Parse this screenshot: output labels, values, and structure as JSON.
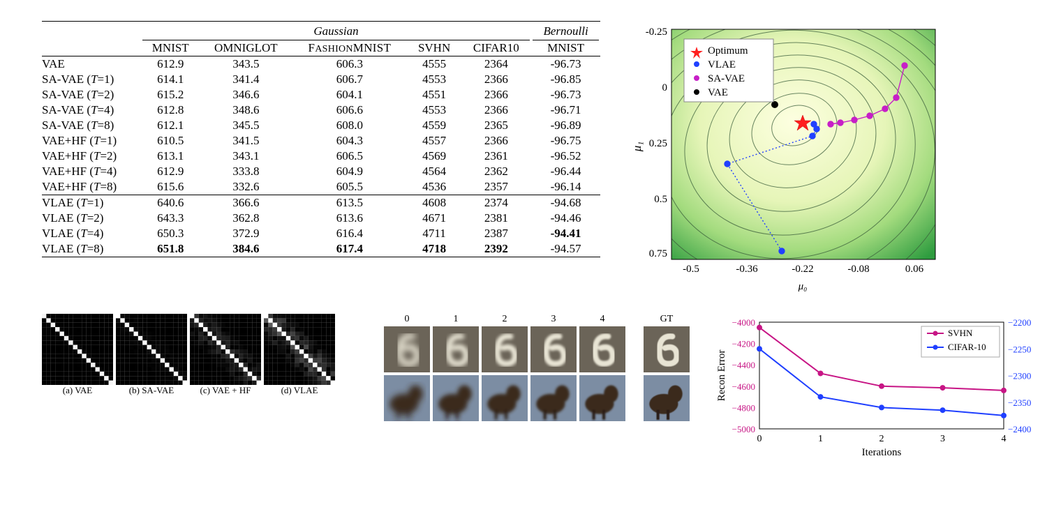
{
  "table": {
    "group1": "Gaussian",
    "group2": "Bernoulli",
    "cols": [
      "MNIST",
      "OMNIGLOT",
      "FASHIONMNIST",
      "SVHN",
      "CIFAR10"
    ],
    "col_b": "MNIST",
    "rows": [
      {
        "name": "VAE",
        "v": [
          "612.9",
          "343.5",
          "606.3",
          "4555",
          "2364",
          "-96.73"
        ]
      },
      {
        "name": "SA-VAE (T=1)",
        "v": [
          "614.1",
          "341.4",
          "606.7",
          "4553",
          "2366",
          "-96.85"
        ]
      },
      {
        "name": "SA-VAE (T=2)",
        "v": [
          "615.2",
          "346.6",
          "604.1",
          "4551",
          "2366",
          "-96.73"
        ]
      },
      {
        "name": "SA-VAE (T=4)",
        "v": [
          "612.8",
          "348.6",
          "606.6",
          "4553",
          "2366",
          "-96.71"
        ]
      },
      {
        "name": "SA-VAE (T=8)",
        "v": [
          "612.1",
          "345.5",
          "608.0",
          "4559",
          "2365",
          "-96.89"
        ]
      },
      {
        "name": "VAE+HF (T=1)",
        "v": [
          "610.5",
          "341.5",
          "604.3",
          "4557",
          "2366",
          "-96.75"
        ]
      },
      {
        "name": "VAE+HF (T=2)",
        "v": [
          "613.1",
          "343.1",
          "606.5",
          "4569",
          "2361",
          "-96.52"
        ]
      },
      {
        "name": "VAE+HF (T=4)",
        "v": [
          "612.9",
          "333.8",
          "604.9",
          "4564",
          "2362",
          "-96.44"
        ]
      },
      {
        "name": "VAE+HF (T=8)",
        "v": [
          "615.6",
          "332.6",
          "605.5",
          "4536",
          "2357",
          "-96.14"
        ]
      },
      {
        "name": "VLAE (T=1)",
        "v": [
          "640.6",
          "366.6",
          "613.5",
          "4608",
          "2374",
          "-94.68"
        ]
      },
      {
        "name": "VLAE (T=2)",
        "v": [
          "643.3",
          "362.8",
          "613.6",
          "4671",
          "2381",
          "-94.46"
        ]
      },
      {
        "name": "VLAE (T=4)",
        "v": [
          "650.3",
          "372.9",
          "616.4",
          "4711",
          "2387",
          "-94.41"
        ],
        "bold_last": true
      },
      {
        "name": "VLAE (T=8)",
        "v": [
          "651.8",
          "384.6",
          "617.4",
          "4718",
          "2392",
          "-94.57"
        ],
        "bold_first5": true
      }
    ]
  },
  "contour": {
    "xlabel": "μ₀",
    "ylabel": "μ₁",
    "xticks": [
      "-0.5",
      "-0.36",
      "-0.22",
      "-0.08",
      "0.06"
    ],
    "yticks": [
      "-0.25",
      "0",
      "0.25",
      "0.5",
      "0.75"
    ],
    "legend": [
      "Optimum",
      "VLAE",
      "SA-VAE",
      "VAE"
    ]
  },
  "mats": {
    "labels": [
      "(a) VAE",
      "(b) SA-VAE",
      "(c) VAE + HF",
      "(d) VLAE"
    ]
  },
  "recon": {
    "iters": [
      "0",
      "1",
      "2",
      "3",
      "4"
    ],
    "gt": "GT"
  },
  "chart_data": {
    "type": "line",
    "title": "",
    "xlabel": "Iterations",
    "ylabel": "Recon Error",
    "x": [
      0,
      1,
      2,
      3,
      4
    ],
    "series": [
      {
        "name": "SVHN",
        "color": "#c71585",
        "axis": "left",
        "values": [
          -4050,
          -4480,
          -4600,
          -4615,
          -4640
        ]
      },
      {
        "name": "CIFAR-10",
        "color": "#1f3fff",
        "axis": "right",
        "values": [
          -2250,
          -2340,
          -2360,
          -2365,
          -2375
        ]
      }
    ],
    "left_axis": {
      "range": [
        -5000,
        -4000
      ],
      "ticks": [
        -4000,
        -4200,
        -4400,
        -4600,
        -4800,
        -5000
      ],
      "color": "#c71585"
    },
    "right_axis": {
      "range": [
        -2400,
        -2200
      ],
      "ticks": [
        -2200,
        -2250,
        -2300,
        -2350,
        -2400
      ],
      "color": "#1f3fff"
    }
  }
}
